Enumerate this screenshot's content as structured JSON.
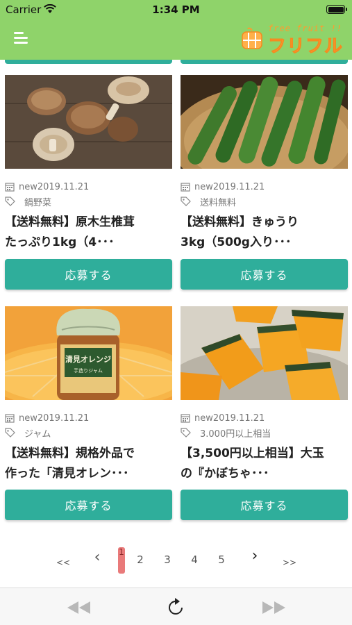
{
  "status_bar": {
    "carrier": "Carrier",
    "time": "1:34 PM"
  },
  "header": {
    "logo_en": "free fruit !!",
    "logo_jp": "フリフル",
    "icons": {
      "menu": "hamburger-icon",
      "logo_mark": "logo-mark-icon"
    }
  },
  "cards": [
    {
      "image": "shiitake-mushrooms",
      "date": "new2019.11.21",
      "tag": "鍋野菜",
      "title_line1": "【送料無料】原木生椎茸",
      "title_line2": "たっぷり1kg（4･･･",
      "button": "応募する"
    },
    {
      "image": "cucumbers-in-basket",
      "date": "new2019.11.21",
      "tag": "送料無料",
      "title_line1": "【送料無料】きゅうり",
      "title_line2": "3kg（500g入り･･･",
      "button": "応募する"
    },
    {
      "image": "orange-jam-jar",
      "date": "new2019.11.21",
      "tag": "ジャム",
      "title_line1": "【送料無料】規格外品で",
      "title_line2": "作った「清見オレン･･･",
      "button": "応募する",
      "jar_label": "清見オレンジ",
      "jar_sublabel": "手造りジャム"
    },
    {
      "image": "kabocha-squash",
      "date": "new2019.11.21",
      "tag": "3.000円以上相当",
      "title_line1": "【3,500円以上相当】大玉",
      "title_line2": "の『かぼちゃ･･･",
      "button": "応募する"
    }
  ],
  "pagination": {
    "first": "<<",
    "prev": "‹",
    "pages": [
      "1",
      "2",
      "3",
      "4",
      "5"
    ],
    "current": "1",
    "next": "›",
    "last": ">>"
  },
  "toolbar": {
    "icons": [
      "rewind-icon",
      "reload-icon",
      "fast-forward-icon"
    ]
  },
  "colors": {
    "header": "#8fd36a",
    "accent": "#2fae9b",
    "active_page": "#e97a7a",
    "logo": "#ffb04a"
  }
}
